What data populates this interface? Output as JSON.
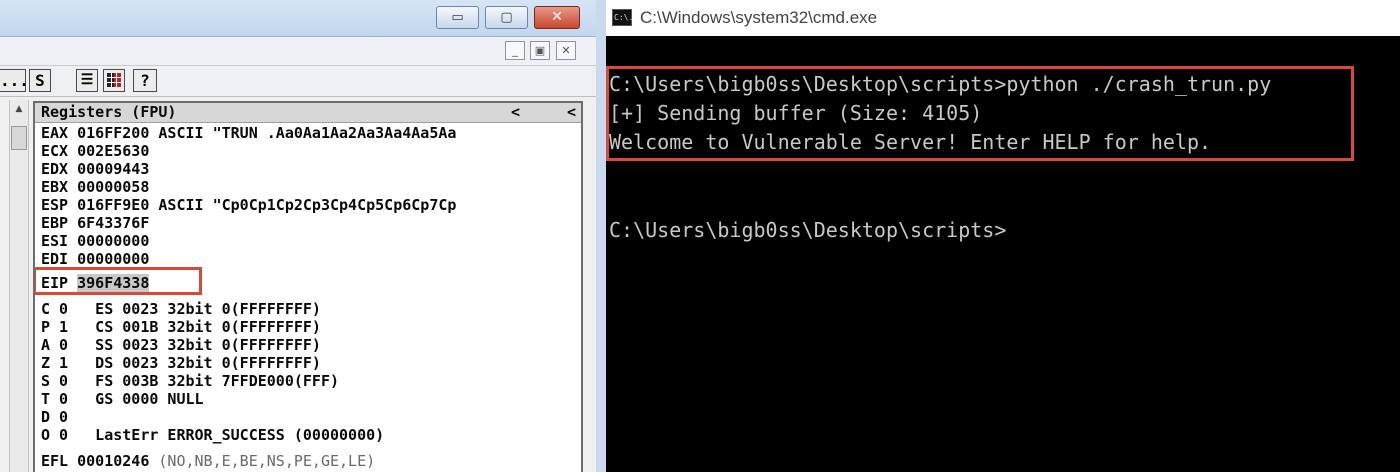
{
  "debugger": {
    "titlebar": {
      "minimize_glyph": "▭",
      "maximize_glyph": "▢",
      "close_glyph": "✕"
    },
    "mdi": {
      "minimize_glyph": "_",
      "restore_glyph": "▣",
      "close_glyph": "✕"
    },
    "toolbar": {
      "dots_label": "...",
      "s_label": "S",
      "list_label": "☰",
      "help_label": "?"
    },
    "scroll": {
      "up_glyph": "▲"
    },
    "registers": {
      "header": "Registers (FPU)",
      "arrow_left_1": "<",
      "arrow_left_2": "<",
      "lines": [
        "EAX 016FF200 ASCII \"TRUN .Aa0Aa1Aa2Aa3Aa4Aa5Aa",
        "ECX 002E5630",
        "EDX 00009443",
        "EBX 00000058",
        "ESP 016FF9E0 ASCII \"Cp0Cp1Cp2Cp3Cp4Cp5Cp6Cp7Cp",
        "EBP 6F43376F",
        "ESI 00000000",
        "EDI 00000000"
      ],
      "eip_name": "EIP",
      "eip_value": "396F4338",
      "flags": [
        "C 0   ES 0023 32bit 0(FFFFFFFF)",
        "P 1   CS 001B 32bit 0(FFFFFFFF)",
        "A 0   SS 0023 32bit 0(FFFFFFFF)",
        "Z 1   DS 0023 32bit 0(FFFFFFFF)",
        "S 0   FS 003B 32bit 7FFDE000(FFF)",
        "T 0   GS 0000 NULL",
        "D 0",
        "O 0   LastErr ERROR_SUCCESS (00000000)"
      ],
      "efl_label": "EFL 00010246",
      "efl_desc": "(NO,NB,E,BE,NS,PE,GE,LE)"
    },
    "highlight_color": "#d74a33"
  },
  "cmd": {
    "title": "C:\\Windows\\system32\\cmd.exe",
    "icon_text": "C:\\.",
    "lines": [
      "C:\\Users\\bigb0ss\\Desktop\\scripts>python ./crash_trun.py",
      "[+] Sending buffer (Size: 4105)",
      "Welcome to Vulnerable Server! Enter HELP for help."
    ],
    "prompt": "C:\\Users\\bigb0ss\\Desktop\\scripts>"
  }
}
